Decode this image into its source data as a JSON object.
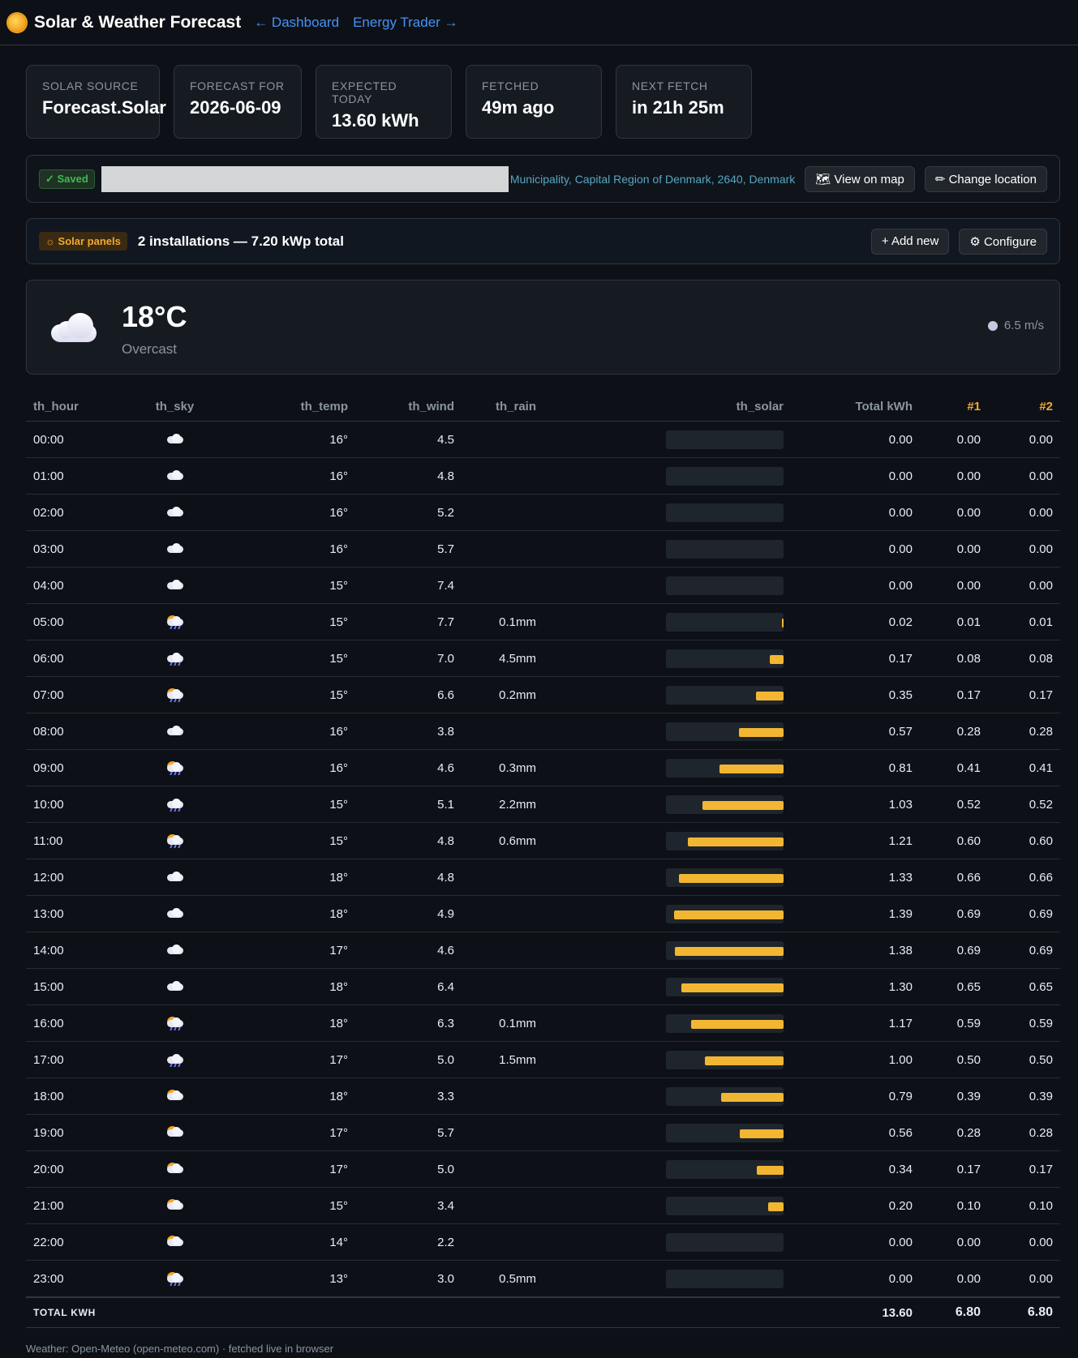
{
  "header": {
    "title": "Solar & Weather Forecast",
    "link_dashboard": "← Dashboard",
    "link_trader": "Energy Trader →"
  },
  "stats": [
    {
      "label": "Solar source",
      "value": "Forecast.Solar"
    },
    {
      "label": "Forecast for",
      "value": "2026-06-09"
    },
    {
      "label": "Expected today",
      "value": "13.60 kWh"
    },
    {
      "label": "Fetched",
      "value": "49m ago"
    },
    {
      "label": "Next fetch",
      "value": "in 21h 25m"
    }
  ],
  "location": {
    "saved_label": "✓ Saved",
    "address": "Municipality, Capital Region of Denmark, 2640, Denmark",
    "view_map_label": "🗺 View on map",
    "change_label": "✏ Change location"
  },
  "panels": {
    "badge": "☼ Solar panels",
    "summary": "2 installations — 7.20 kWp total",
    "add_label": "+ Add new",
    "configure_label": "⚙ Configure"
  },
  "current": {
    "temp": "18°C",
    "condition": "Overcast",
    "wind": "6.5 m/s"
  },
  "table": {
    "headers": {
      "hour": "th_hour",
      "sky": "th_sky",
      "temp": "th_temp",
      "wind": "th_wind",
      "rain": "th_rain",
      "solar": "th_solar",
      "total": "Total kWh",
      "p1": "#1",
      "p2": "#2"
    },
    "max_kwh": 1.39,
    "rows": [
      {
        "hour": "00:00",
        "sky": "cloud",
        "temp": "16°",
        "wind": "4.5",
        "rain": "",
        "total": "0.00",
        "p1": "0.00",
        "p2": "0.00"
      },
      {
        "hour": "01:00",
        "sky": "cloud",
        "temp": "16°",
        "wind": "4.8",
        "rain": "",
        "total": "0.00",
        "p1": "0.00",
        "p2": "0.00"
      },
      {
        "hour": "02:00",
        "sky": "cloud",
        "temp": "16°",
        "wind": "5.2",
        "rain": "",
        "total": "0.00",
        "p1": "0.00",
        "p2": "0.00"
      },
      {
        "hour": "03:00",
        "sky": "cloud",
        "temp": "16°",
        "wind": "5.7",
        "rain": "",
        "total": "0.00",
        "p1": "0.00",
        "p2": "0.00"
      },
      {
        "hour": "04:00",
        "sky": "cloud",
        "temp": "15°",
        "wind": "7.4",
        "rain": "",
        "total": "0.00",
        "p1": "0.00",
        "p2": "0.00"
      },
      {
        "hour": "05:00",
        "sky": "sun-rain",
        "temp": "15°",
        "wind": "7.7",
        "rain": "0.1mm",
        "total": "0.02",
        "p1": "0.01",
        "p2": "0.01"
      },
      {
        "hour": "06:00",
        "sky": "rain",
        "temp": "15°",
        "wind": "7.0",
        "rain": "4.5mm",
        "total": "0.17",
        "p1": "0.08",
        "p2": "0.08"
      },
      {
        "hour": "07:00",
        "sky": "sun-rain",
        "temp": "15°",
        "wind": "6.6",
        "rain": "0.2mm",
        "total": "0.35",
        "p1": "0.17",
        "p2": "0.17"
      },
      {
        "hour": "08:00",
        "sky": "cloud",
        "temp": "16°",
        "wind": "3.8",
        "rain": "",
        "total": "0.57",
        "p1": "0.28",
        "p2": "0.28"
      },
      {
        "hour": "09:00",
        "sky": "sun-rain",
        "temp": "16°",
        "wind": "4.6",
        "rain": "0.3mm",
        "total": "0.81",
        "p1": "0.41",
        "p2": "0.41"
      },
      {
        "hour": "10:00",
        "sky": "rain",
        "temp": "15°",
        "wind": "5.1",
        "rain": "2.2mm",
        "total": "1.03",
        "p1": "0.52",
        "p2": "0.52"
      },
      {
        "hour": "11:00",
        "sky": "sun-rain",
        "temp": "15°",
        "wind": "4.8",
        "rain": "0.6mm",
        "total": "1.21",
        "p1": "0.60",
        "p2": "0.60"
      },
      {
        "hour": "12:00",
        "sky": "cloud",
        "temp": "18°",
        "wind": "4.8",
        "rain": "",
        "total": "1.33",
        "p1": "0.66",
        "p2": "0.66"
      },
      {
        "hour": "13:00",
        "sky": "cloud",
        "temp": "18°",
        "wind": "4.9",
        "rain": "",
        "total": "1.39",
        "p1": "0.69",
        "p2": "0.69"
      },
      {
        "hour": "14:00",
        "sky": "cloud",
        "temp": "17°",
        "wind": "4.6",
        "rain": "",
        "total": "1.38",
        "p1": "0.69",
        "p2": "0.69"
      },
      {
        "hour": "15:00",
        "sky": "cloud",
        "temp": "18°",
        "wind": "6.4",
        "rain": "",
        "total": "1.30",
        "p1": "0.65",
        "p2": "0.65"
      },
      {
        "hour": "16:00",
        "sky": "sun-rain",
        "temp": "18°",
        "wind": "6.3",
        "rain": "0.1mm",
        "total": "1.17",
        "p1": "0.59",
        "p2": "0.59"
      },
      {
        "hour": "17:00",
        "sky": "rain",
        "temp": "17°",
        "wind": "5.0",
        "rain": "1.5mm",
        "total": "1.00",
        "p1": "0.50",
        "p2": "0.50"
      },
      {
        "hour": "18:00",
        "sky": "sun-cloud",
        "temp": "18°",
        "wind": "3.3",
        "rain": "",
        "total": "0.79",
        "p1": "0.39",
        "p2": "0.39"
      },
      {
        "hour": "19:00",
        "sky": "sun-cloud",
        "temp": "17°",
        "wind": "5.7",
        "rain": "",
        "total": "0.56",
        "p1": "0.28",
        "p2": "0.28"
      },
      {
        "hour": "20:00",
        "sky": "sun-cloud",
        "temp": "17°",
        "wind": "5.0",
        "rain": "",
        "total": "0.34",
        "p1": "0.17",
        "p2": "0.17"
      },
      {
        "hour": "21:00",
        "sky": "sun-cloud",
        "temp": "15°",
        "wind": "3.4",
        "rain": "",
        "total": "0.20",
        "p1": "0.10",
        "p2": "0.10"
      },
      {
        "hour": "22:00",
        "sky": "sun-cloud",
        "temp": "14°",
        "wind": "2.2",
        "rain": "",
        "total": "0.00",
        "p1": "0.00",
        "p2": "0.00"
      },
      {
        "hour": "23:00",
        "sky": "sun-rain",
        "temp": "13°",
        "wind": "3.0",
        "rain": "0.5mm",
        "total": "0.00",
        "p1": "0.00",
        "p2": "0.00"
      }
    ],
    "totals": {
      "label": "TOTAL KWH",
      "total": "13.60",
      "p1": "6.80",
      "p2": "6.80"
    }
  },
  "footer": "Weather: Open-Meteo (open-meteo.com) · fetched live in browser",
  "colors": {
    "accent": "#4493f8",
    "solar": "#f2b632",
    "saved": "#3fb950"
  }
}
